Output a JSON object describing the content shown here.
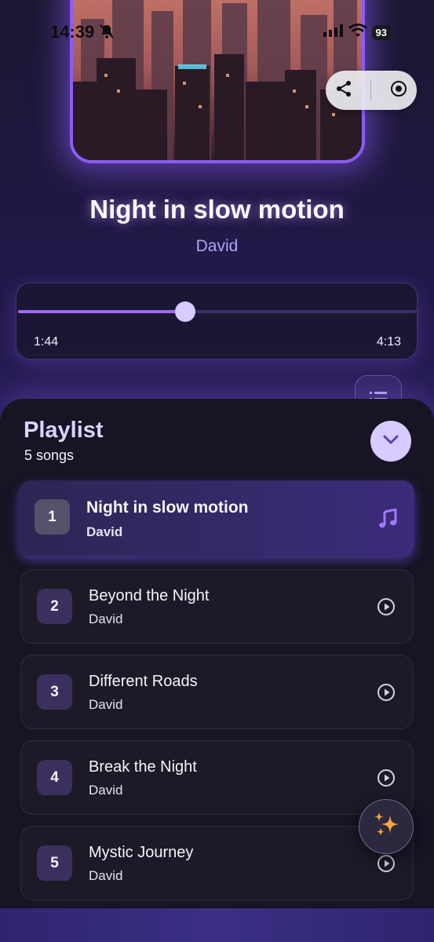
{
  "status_bar": {
    "time": "14:39",
    "battery": "93"
  },
  "now_playing": {
    "title": "Night in slow motion",
    "artist": "David",
    "elapsed": "1:44",
    "duration": "4:13",
    "progress_fraction": 0.42
  },
  "playlist": {
    "title": "Playlist",
    "count_label": "5 songs",
    "songs": [
      {
        "num": "1",
        "title": "Night in slow motion",
        "artist": "David",
        "active": true
      },
      {
        "num": "2",
        "title": "Beyond the Night",
        "artist": "David",
        "active": false
      },
      {
        "num": "3",
        "title": "Different Roads",
        "artist": "David",
        "active": false
      },
      {
        "num": "4",
        "title": "Break the Night",
        "artist": "David",
        "active": false
      },
      {
        "num": "5",
        "title": "Mystic Journey",
        "artist": "David",
        "active": false
      }
    ]
  },
  "icons": {
    "share": "share-icon",
    "record": "record-icon",
    "queue": "list-icon",
    "collapse": "chevron-down-icon",
    "now_playing": "music-note-icon",
    "play": "play-circle-icon",
    "ai": "sparkles-icon"
  },
  "colors": {
    "accent": "#8b5cf6",
    "thumb": "#d8cbff",
    "artist": "#a9a6f6"
  }
}
